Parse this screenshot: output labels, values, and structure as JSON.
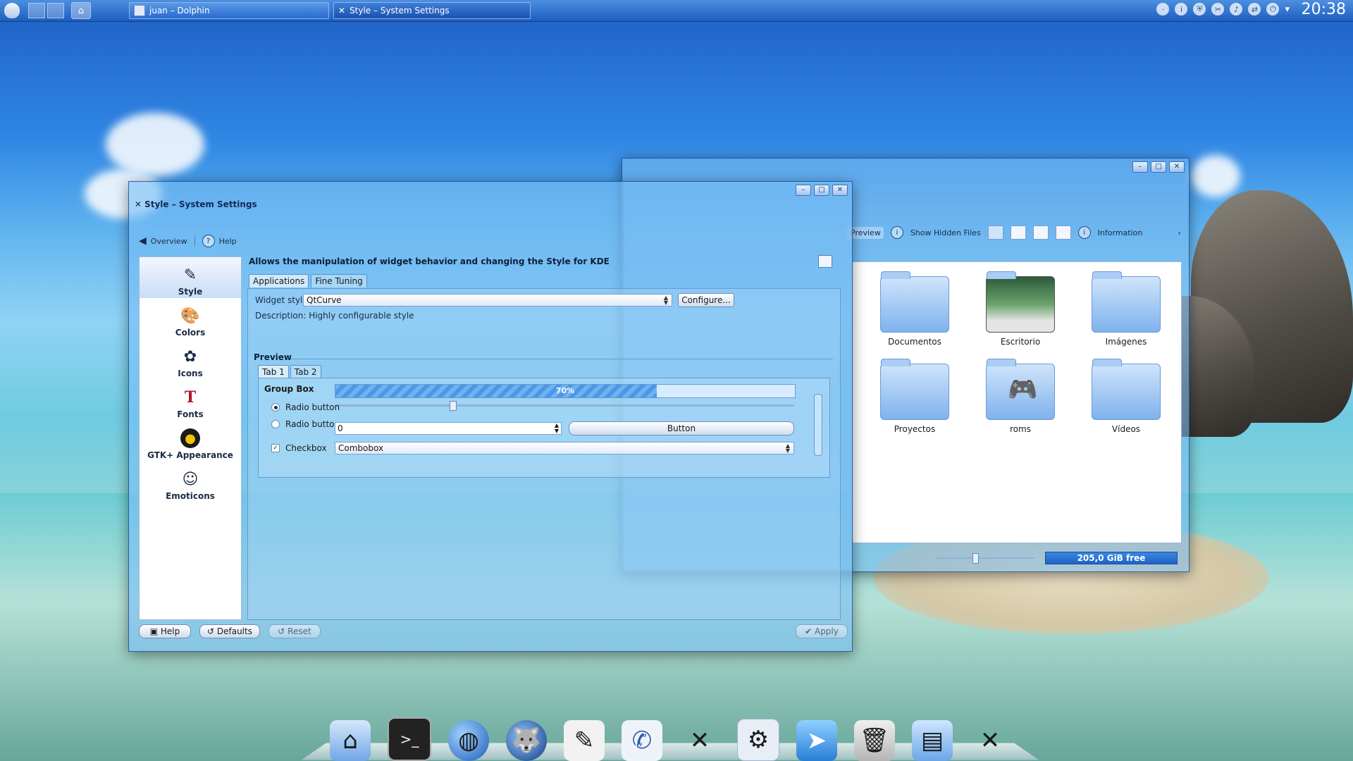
{
  "panel": {
    "clock": "20:38",
    "tasks": [
      {
        "label": "juan – Dolphin"
      },
      {
        "label": "Style – System Settings"
      }
    ]
  },
  "dolphin": {
    "toolbar": {
      "preview": "Preview",
      "show_hidden": "Show Hidden Files",
      "information": "Information"
    },
    "folders": [
      {
        "name": "Documentos"
      },
      {
        "name": "Escritorio"
      },
      {
        "name": "Imágenes"
      },
      {
        "name": "Proyectos"
      },
      {
        "name": "roms"
      },
      {
        "name": "Vídeos"
      }
    ],
    "free_space": "205,0 GiB free"
  },
  "settings": {
    "title": "Style – System Settings",
    "toolbar": {
      "overview": "Overview",
      "help": "Help"
    },
    "sidebar": [
      {
        "label": "Style"
      },
      {
        "label": "Colors"
      },
      {
        "label": "Icons"
      },
      {
        "label": "Fonts"
      },
      {
        "label": "GTK+ Appearance"
      },
      {
        "label": "Emoticons"
      }
    ],
    "description_header": "Allows the manipulation of widget behavior and changing the Style for KDE",
    "tabs": [
      {
        "label": "Applications"
      },
      {
        "label": "Fine Tuning"
      }
    ],
    "widget_style_label": "Widget style:",
    "widget_style_value": "QtCurve",
    "configure_button": "Configure...",
    "description": "Description: Highly configurable style",
    "preview_label": "Preview",
    "preview_tabs": [
      {
        "label": "Tab 1"
      },
      {
        "label": "Tab 2"
      }
    ],
    "group_box": "Group Box",
    "progress": {
      "value": 0.7,
      "label": "70%"
    },
    "slider_value": 0.25,
    "radio1": "Radio button",
    "radio2": "Radio button",
    "spinbox_value": "0",
    "button_label": "Button",
    "checkbox_label": "Checkbox",
    "checkbox_checked": true,
    "combobox_value": "Combobox",
    "bottom": {
      "help": "Help",
      "defaults": "Defaults",
      "reset": "Reset",
      "apply": "Apply"
    }
  },
  "dock": {
    "icons": [
      "home-folder-icon",
      "terminal-icon",
      "globe-icon",
      "firefox-icon",
      "text-editor-icon",
      "pdf-viewer-icon",
      "tools-icon",
      "settings-window-icon",
      "pointer-icon",
      "trash-icon",
      "file-cabinet-icon",
      "system-settings-icon"
    ]
  }
}
